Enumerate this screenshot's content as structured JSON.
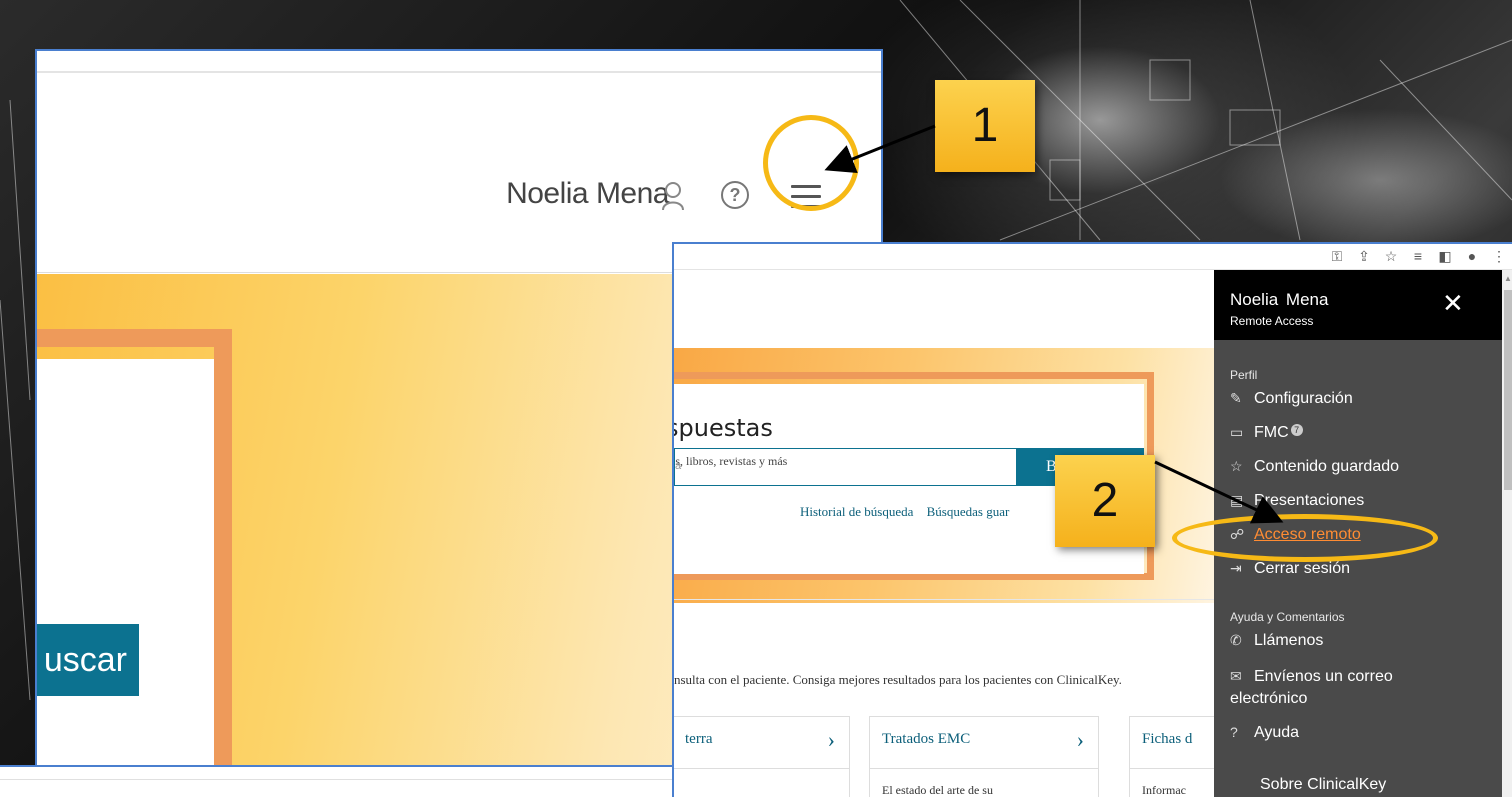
{
  "panel1": {
    "user_name": "Noelia Mena",
    "search_button_fragment": "uscar"
  },
  "panel2": {
    "title_fragment": "spuestas",
    "subtitle_fragment": "tos, libros, revistas y más",
    "search_placeholder_fragment": "a",
    "search_button_fragment": "Bu",
    "links": [
      "Historial de búsqueda",
      "Búsquedas guar"
    ],
    "description_fragment": "nsulta con el paciente. Consiga mejores resultados para los pacientes con ClinicalKey.",
    "tiles": [
      {
        "title": "terra",
        "body": ""
      },
      {
        "title": "Tratados EMC",
        "body": "El estado del arte de su"
      },
      {
        "title": "Fichas d",
        "body": "Informac"
      }
    ]
  },
  "menu": {
    "user_name": "Noelia  Mena",
    "role": "Remote Access",
    "section_profile": "Perfil",
    "items_profile": [
      {
        "label": "Configuración",
        "icon": "wrench-icon"
      },
      {
        "label": "FMC",
        "icon": "briefcase-icon",
        "badge": "7"
      },
      {
        "label": "Contenido guardado",
        "icon": "star-icon"
      },
      {
        "label": "Presentaciones",
        "icon": "presentation-icon"
      },
      {
        "label": "Acceso remoto",
        "icon": "remote-icon"
      },
      {
        "label": "Cerrar sesión",
        "icon": "logout-icon"
      }
    ],
    "section_help": "Ayuda y Comentarios",
    "items_help": [
      {
        "label": "Llámenos",
        "icon": "phone-icon"
      },
      {
        "label": "Envíenos un correo",
        "icon": "mail-icon"
      },
      {
        "label": "electrónico"
      },
      {
        "label": "Ayuda",
        "icon": "help-icon"
      },
      {
        "label": "Sobre ClinicalKey"
      }
    ]
  },
  "annotations": {
    "step1": "1",
    "step2": "2",
    "highlight_color": "#f6b916"
  },
  "colors": {
    "accent_teal": "#0c7290",
    "active_orange": "#ff8c33",
    "menu_bg": "#4a4a4a"
  }
}
